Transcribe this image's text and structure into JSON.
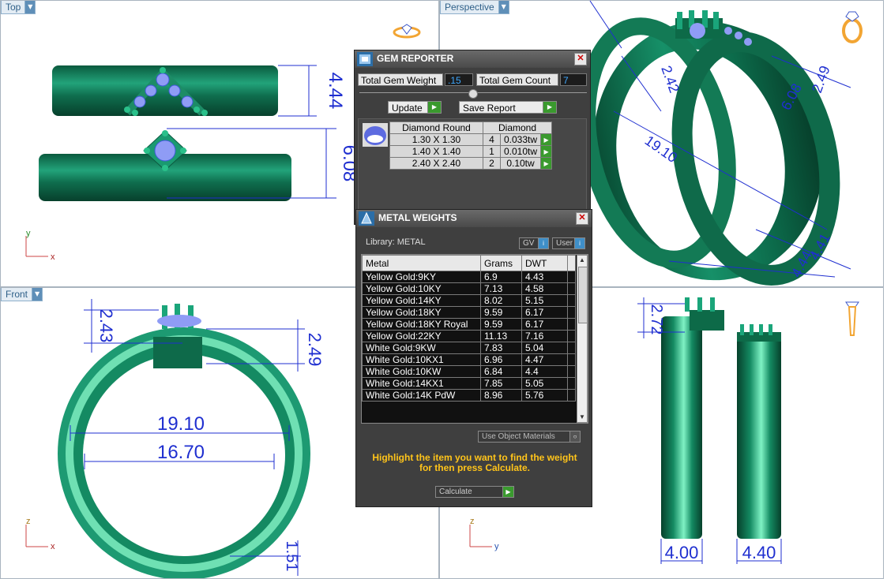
{
  "viewports": {
    "top": {
      "label": "Top",
      "axis_a": "y",
      "axis_b": "x",
      "dims": [
        "4.44",
        "6.08"
      ]
    },
    "perspective": {
      "label": "Perspective",
      "dims": [
        "19.10",
        "2.42",
        "6.08",
        "2.49",
        "4.41",
        "4.44"
      ]
    },
    "front": {
      "label": "Front",
      "axis_a": "z",
      "axis_b": "x",
      "dims": [
        "2.43",
        "2.49",
        "19.10",
        "16.70",
        "1.51"
      ]
    },
    "right": {
      "axis_a": "z",
      "axis_b": "y",
      "dims": [
        "2.72",
        "4.00",
        "4.40"
      ]
    }
  },
  "gem_reporter": {
    "title": "GEM REPORTER",
    "total_weight_label": "Total Gem Weight",
    "total_weight_value": ".15",
    "total_count_label": "Total Gem Count",
    "total_count_value": "7",
    "update_label": "Update",
    "save_report_label": "Save Report",
    "table_header": [
      "Diamond Round",
      "Diamond"
    ],
    "rows": [
      {
        "size": "1.30 X 1.30",
        "count": "4",
        "weight": "0.033tw"
      },
      {
        "size": "1.40 X 1.40",
        "count": "1",
        "weight": "0.010tw"
      },
      {
        "size": "2.40 X 2.40",
        "count": "2",
        "weight": "0.10tw"
      }
    ]
  },
  "metal_weights": {
    "title": "METAL WEIGHTS",
    "library_label": "Library: METAL",
    "gv_label": "GV",
    "user_label": "User",
    "columns": [
      "Metal",
      "Grams",
      "DWT"
    ],
    "rows": [
      {
        "metal": "Yellow Gold:9KY",
        "grams": "6.9",
        "dwt": "4.43"
      },
      {
        "metal": "Yellow Gold:10KY",
        "grams": "7.13",
        "dwt": "4.58"
      },
      {
        "metal": "Yellow Gold:14KY",
        "grams": "8.02",
        "dwt": "5.15"
      },
      {
        "metal": "Yellow Gold:18KY",
        "grams": "9.59",
        "dwt": "6.17"
      },
      {
        "metal": "Yellow Gold:18KY Royal",
        "grams": "9.59",
        "dwt": "6.17"
      },
      {
        "metal": "Yellow Gold:22KY",
        "grams": "11.13",
        "dwt": "7.16"
      },
      {
        "metal": "White Gold:9KW",
        "grams": "7.83",
        "dwt": "5.04"
      },
      {
        "metal": "White Gold:10KX1",
        "grams": "6.96",
        "dwt": "4.47"
      },
      {
        "metal": "White Gold:10KW",
        "grams": "6.84",
        "dwt": "4.4"
      },
      {
        "metal": "White Gold:14KX1",
        "grams": "7.85",
        "dwt": "5.05"
      },
      {
        "metal": "White Gold:14K PdW",
        "grams": "8.96",
        "dwt": "5.76"
      }
    ],
    "use_object_materials_label": "Use Object Materials",
    "hint": "Highlight the item you want to find the weight for then press Calculate.",
    "calculate_label": "Calculate"
  }
}
